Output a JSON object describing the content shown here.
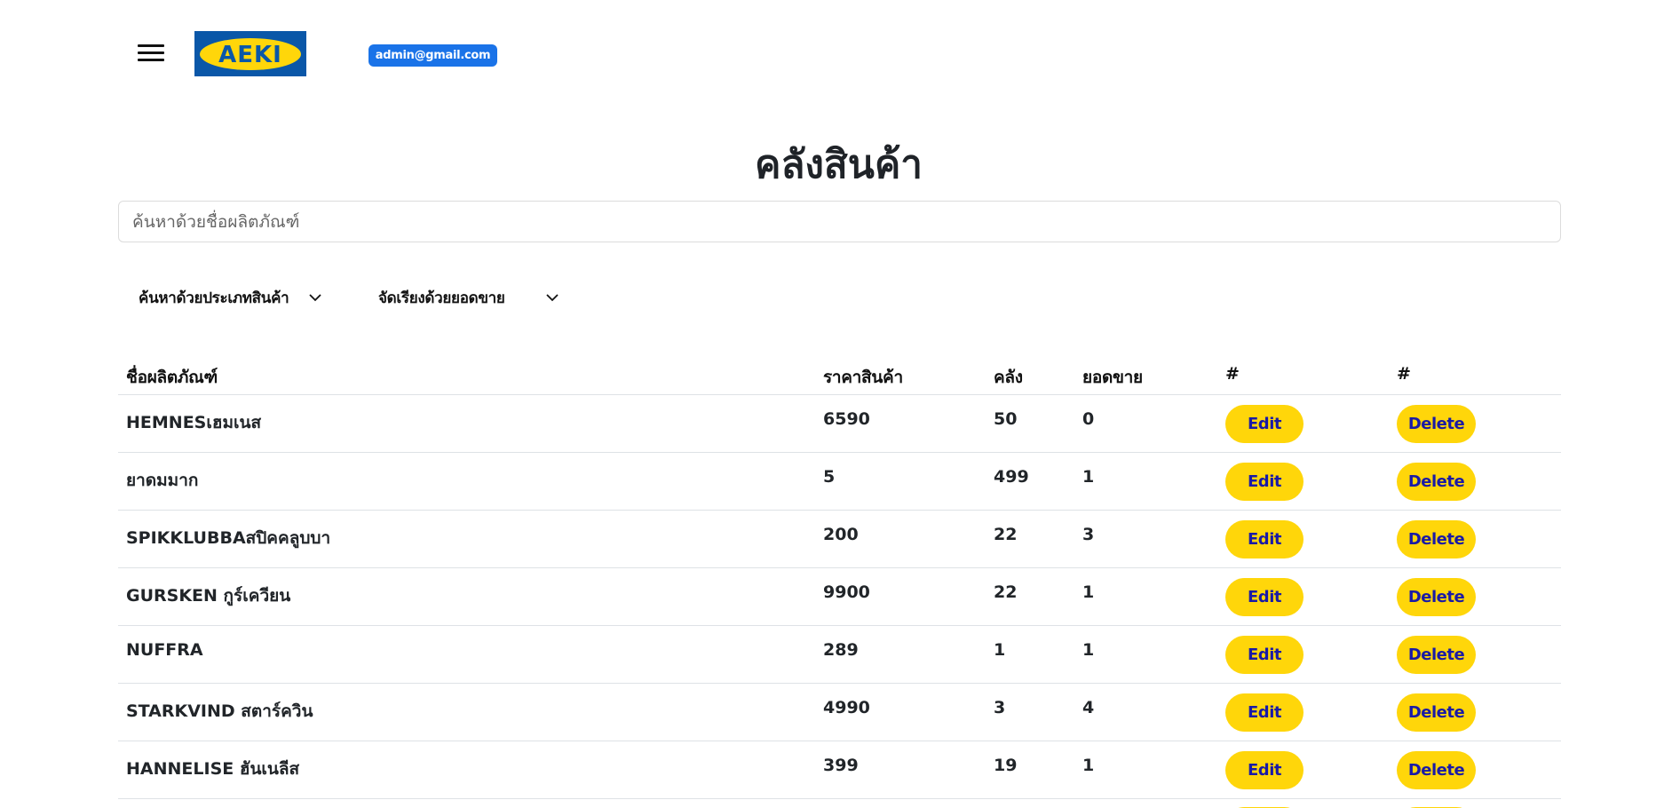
{
  "header": {
    "menu_icon": "hamburger-menu-icon",
    "logo_text": "AEKI",
    "user_email": "admin@gmail.com"
  },
  "page": {
    "title": "คลังสินค้า"
  },
  "search": {
    "placeholder": "ค้นหาด้วยชื่อผลิตภัณฑ์"
  },
  "filters": {
    "category_label": "ค้นหาด้วยประเภทสินค้า",
    "sort_label": "จัดเรียงด้วยยอดขาย"
  },
  "table": {
    "headers": {
      "name": "ชื่อผลิตภัณฑ์",
      "price": "ราคาสินค้า",
      "stock": "คลัง",
      "sales": "ยอดขาย",
      "edit": "#",
      "delete": "#"
    },
    "edit_label": "Edit",
    "delete_label": "Delete",
    "rows": [
      {
        "name": "HEMNESเฮมเนส",
        "price": "6590",
        "stock": "50",
        "sales": "0"
      },
      {
        "name": "ยาดมมาก",
        "price": "5",
        "stock": "499",
        "sales": "1"
      },
      {
        "name": "SPIKKLUBBAสปิคคลูบบา",
        "price": "200",
        "stock": "22",
        "sales": "3"
      },
      {
        "name": "GURSKEN กูร์เควียน",
        "price": "9900",
        "stock": "22",
        "sales": "1"
      },
      {
        "name": "NUFFRA",
        "price": "289",
        "stock": "1",
        "sales": "1"
      },
      {
        "name": "STARKVIND สตาร์ควิน",
        "price": "4990",
        "stock": "3",
        "sales": "4"
      },
      {
        "name": "HANNELISE ฮันเนลีส",
        "price": "399",
        "stock": "19",
        "sales": "1"
      }
    ]
  },
  "colors": {
    "accent_yellow": "#ffd60a",
    "button_text": "#1a1aa6",
    "badge_blue": "#1a73e8",
    "logo_blue": "#0a57a8"
  }
}
